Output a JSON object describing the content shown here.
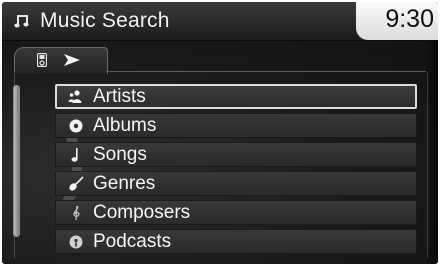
{
  "header": {
    "title": "Music Search",
    "clock": "9:30",
    "icon": "music-note-icon"
  },
  "tabs": {
    "device_icon": "ipod-device-icon",
    "arrow_icon": "play-arrow-icon"
  },
  "scrollbar": {
    "fraction_visible": 1.0
  },
  "menu": {
    "selected_index": 0,
    "items": [
      {
        "label": "Artists",
        "icon": "artist-icon"
      },
      {
        "label": "Albums",
        "icon": "album-icon"
      },
      {
        "label": "Songs",
        "icon": "song-note-icon"
      },
      {
        "label": "Genres",
        "icon": "guitar-icon"
      },
      {
        "label": "Composers",
        "icon": "treble-clef-icon"
      },
      {
        "label": "Podcasts",
        "icon": "podcast-icon"
      }
    ]
  },
  "colors": {
    "background": "#141414",
    "text": "#f4f4f4",
    "clock_bg": "#f2f2f2",
    "selection_border": "#dcdcdc"
  }
}
